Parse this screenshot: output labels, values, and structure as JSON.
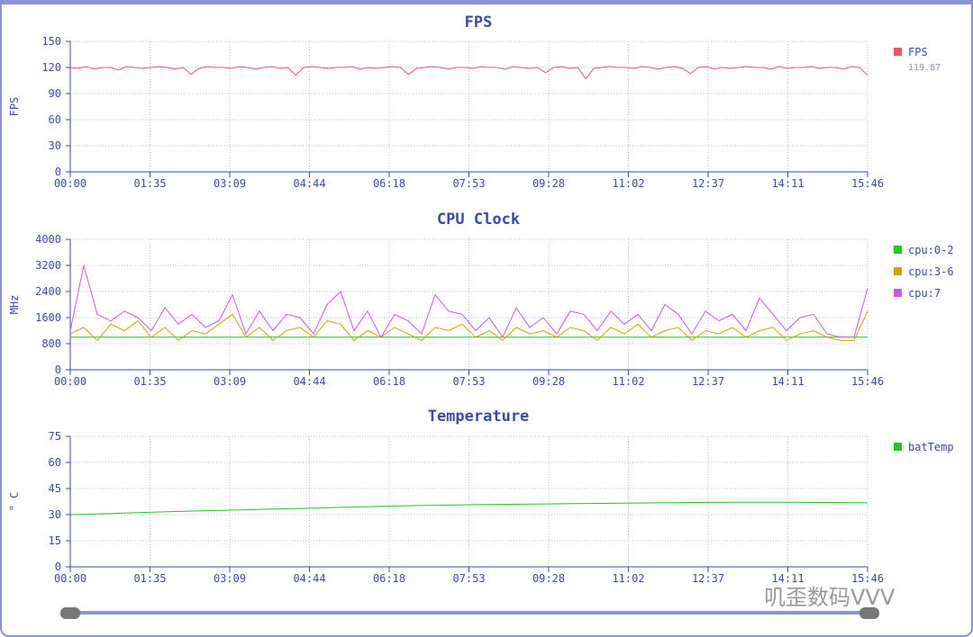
{
  "chart_data": [
    {
      "type": "line",
      "title": "FPS",
      "ylabel": "FPS",
      "ylim": [
        0,
        150
      ],
      "yticks": [
        0,
        30,
        60,
        90,
        120,
        150
      ],
      "xticks": [
        "00:00",
        "01:35",
        "03:09",
        "04:44",
        "06:18",
        "07:53",
        "09:28",
        "11:02",
        "12:37",
        "14:11",
        "15:46"
      ],
      "legend": [
        {
          "name": "FPS",
          "color": "#e8566a",
          "value": "119.87"
        }
      ],
      "series": [
        {
          "name": "FPS",
          "color": "#e8566a",
          "values": [
            120,
            119,
            121,
            118,
            120,
            120,
            117,
            121,
            120,
            119,
            120,
            121,
            120,
            118,
            120,
            112,
            119,
            121,
            120,
            120,
            119,
            121,
            120,
            118,
            120,
            121,
            119,
            120,
            111,
            120,
            121,
            120,
            119,
            120,
            120,
            121,
            118,
            120,
            119,
            120,
            121,
            120,
            112,
            119,
            120,
            121,
            120,
            118,
            120,
            120,
            119,
            121,
            120,
            120,
            118,
            121,
            120,
            119,
            120,
            114,
            120,
            121,
            119,
            120,
            107,
            119,
            120,
            121,
            120,
            120,
            119,
            121,
            120,
            118,
            120,
            121,
            119,
            113,
            120,
            121,
            118,
            120,
            119,
            120,
            121,
            120,
            120,
            118,
            121,
            119,
            120,
            120,
            121,
            119,
            120,
            120,
            118,
            121,
            120,
            111
          ]
        }
      ]
    },
    {
      "type": "line",
      "title": "CPU Clock",
      "ylabel": "MHz",
      "ylim": [
        0,
        4000
      ],
      "yticks": [
        0,
        800,
        1600,
        2400,
        3200,
        4000
      ],
      "xticks": [
        "00:00",
        "01:35",
        "03:09",
        "04:44",
        "06:18",
        "07:53",
        "09:28",
        "11:02",
        "12:37",
        "14:11",
        "15:46"
      ],
      "legend": [
        {
          "name": "cpu:0-2",
          "color": "#1ec81e"
        },
        {
          "name": "cpu:3-6",
          "color": "#d4a000"
        },
        {
          "name": "cpu:7",
          "color": "#cc55ee"
        }
      ],
      "series": [
        {
          "name": "cpu:0-2",
          "color": "#1ec81e",
          "values": [
            1000,
            1000,
            1000,
            1000,
            1000,
            1000,
            1000,
            1000,
            1000,
            1000,
            1000,
            1000,
            1000,
            1000,
            1000,
            1000,
            1000,
            1000,
            1000,
            1000,
            1000,
            1000,
            1000,
            1000,
            1000,
            1000,
            1000,
            1000,
            1000,
            1000,
            1000,
            1000,
            1000,
            1000,
            1000,
            1000,
            1000,
            1000,
            1000,
            1000,
            1000,
            1000,
            1000,
            1000,
            1000,
            1000,
            1000,
            1000,
            1000,
            1000,
            1000,
            1000,
            1000,
            1000,
            1000,
            1000,
            1000,
            1000,
            1000,
            1000
          ]
        },
        {
          "name": "cpu:3-6",
          "color": "#d4a000",
          "values": [
            1100,
            1300,
            900,
            1400,
            1200,
            1500,
            1000,
            1300,
            900,
            1200,
            1100,
            1400,
            1700,
            1000,
            1300,
            900,
            1200,
            1300,
            1000,
            1500,
            1400,
            900,
            1200,
            1000,
            1300,
            1100,
            900,
            1300,
            1200,
            1400,
            1000,
            1200,
            900,
            1300,
            1100,
            1200,
            1000,
            1300,
            1200,
            900,
            1300,
            1100,
            1400,
            1000,
            1200,
            1300,
            900,
            1200,
            1100,
            1300,
            1000,
            1200,
            1300,
            900,
            1100,
            1200,
            1000,
            900,
            900,
            1800
          ]
        },
        {
          "name": "cpu:7",
          "color": "#cc55ee",
          "values": [
            1200,
            3200,
            1700,
            1500,
            1800,
            1600,
            1200,
            1900,
            1400,
            1700,
            1300,
            1500,
            2300,
            1100,
            1800,
            1200,
            1700,
            1600,
            1100,
            2000,
            2400,
            1200,
            1800,
            1000,
            1700,
            1500,
            1100,
            2300,
            1800,
            1700,
            1200,
            1600,
            1000,
            1900,
            1300,
            1600,
            1100,
            1800,
            1700,
            1200,
            1800,
            1400,
            1700,
            1200,
            2000,
            1700,
            1100,
            1800,
            1500,
            1700,
            1200,
            2200,
            1700,
            1200,
            1600,
            1700,
            1100,
            1000,
            1000,
            2500
          ]
        }
      ]
    },
    {
      "type": "line",
      "title": "Temperature",
      "ylabel": "° C",
      "ylim": [
        0,
        75
      ],
      "yticks": [
        0,
        15,
        30,
        45,
        60,
        75
      ],
      "xticks": [
        "00:00",
        "01:35",
        "03:09",
        "04:44",
        "06:18",
        "07:53",
        "09:28",
        "11:02",
        "12:37",
        "14:11",
        "15:46"
      ],
      "legend": [
        {
          "name": "batTemp",
          "color": "#1ec81e"
        }
      ],
      "series": [
        {
          "name": "batTemp",
          "color": "#1ec81e",
          "values": [
            30,
            30.5,
            31.2,
            31.8,
            32.3,
            32.8,
            33.3,
            33.8,
            34.3,
            34.8,
            35.2,
            35.5,
            35.8,
            36.0,
            36.2,
            36.4,
            36.6,
            36.8,
            37.0,
            37.1,
            37.1,
            37.1,
            37.0,
            36.8
          ]
        }
      ]
    }
  ],
  "watermark": "叽歪数码VVV"
}
